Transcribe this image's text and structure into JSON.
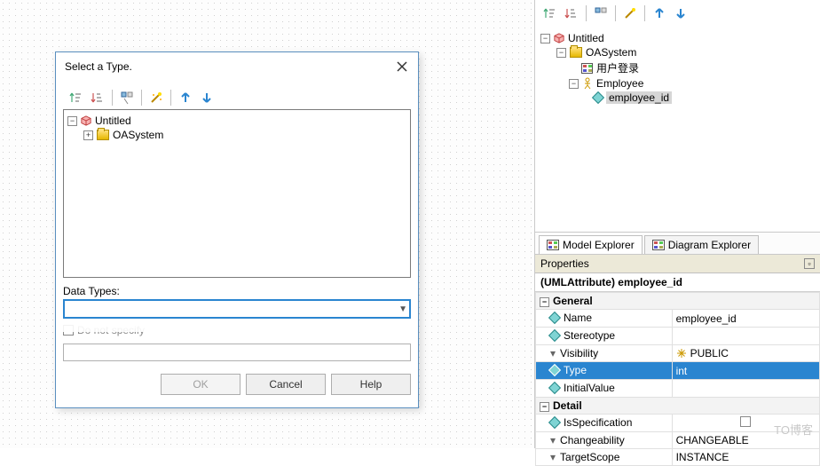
{
  "dialog": {
    "title": "Select a Type.",
    "tree": {
      "root": "Untitled",
      "child1": "OASystem"
    },
    "data_types_label": "Data Types:",
    "combo_value": "",
    "checkbox_label": "Do not specify",
    "buttons": {
      "ok": "OK",
      "cancel": "Cancel",
      "help": "Help"
    }
  },
  "explorer": {
    "root": "Untitled",
    "pkg": "OASystem",
    "diagram": "用户登录",
    "actor": "Employee",
    "attr": "employee_id"
  },
  "tabs": {
    "model": "Model Explorer",
    "diagram": "Diagram Explorer"
  },
  "props": {
    "panel": "Properties",
    "title": "(UMLAttribute) employee_id",
    "groups": {
      "general": "General",
      "detail": "Detail"
    },
    "rows": {
      "name": {
        "label": "Name",
        "value": "employee_id"
      },
      "stereotype": {
        "label": "Stereotype",
        "value": ""
      },
      "visibility": {
        "label": "Visibility",
        "value": "PUBLIC"
      },
      "type": {
        "label": "Type",
        "value": "int"
      },
      "initial": {
        "label": "InitialValue",
        "value": ""
      },
      "isspec": {
        "label": "IsSpecification",
        "value": ""
      },
      "changeability": {
        "label": "Changeability",
        "value": "CHANGEABLE"
      },
      "targetscope": {
        "label": "TargetScope",
        "value": "INSTANCE"
      }
    }
  },
  "watermark": "TO博客"
}
